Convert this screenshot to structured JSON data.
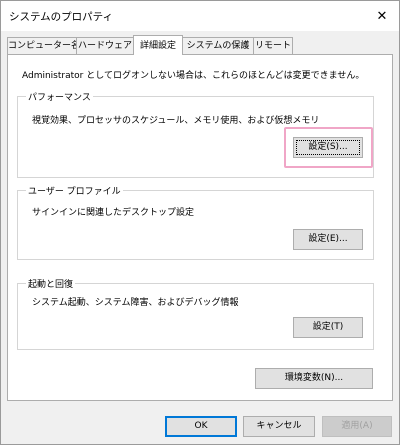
{
  "window": {
    "title": "システムのプロパティ",
    "close_glyph": "✕"
  },
  "tabs": [
    {
      "label": "コンピューター名"
    },
    {
      "label": "ハードウェア"
    },
    {
      "label": "詳細設定"
    },
    {
      "label": "システムの保護"
    },
    {
      "label": "リモート"
    }
  ],
  "active_tab": "詳細設定",
  "notice": "Administrator としてログオンしない場合は、これらのほとんどは変更できません。",
  "groups": {
    "performance": {
      "label": "パフォーマンス",
      "description": "視覚効果、プロセッサのスケジュール、メモリ使用、および仮想メモリ",
      "button": "設定(S)..."
    },
    "user_profile": {
      "label": "ユーザー プロファイル",
      "description": "サインインに関連したデスクトップ設定",
      "button": "設定(E)..."
    },
    "startup_recovery": {
      "label": "起動と回復",
      "description": "システム起動、システム障害、およびデバッグ情報",
      "button": "設定(T)"
    }
  },
  "env_button": "環境変数(N)...",
  "footer": {
    "ok": "OK",
    "cancel": "キャンセル",
    "apply": "適用(A)"
  },
  "colors": {
    "highlight": "#f0a6c7",
    "default_button_border": "#0078d7"
  }
}
